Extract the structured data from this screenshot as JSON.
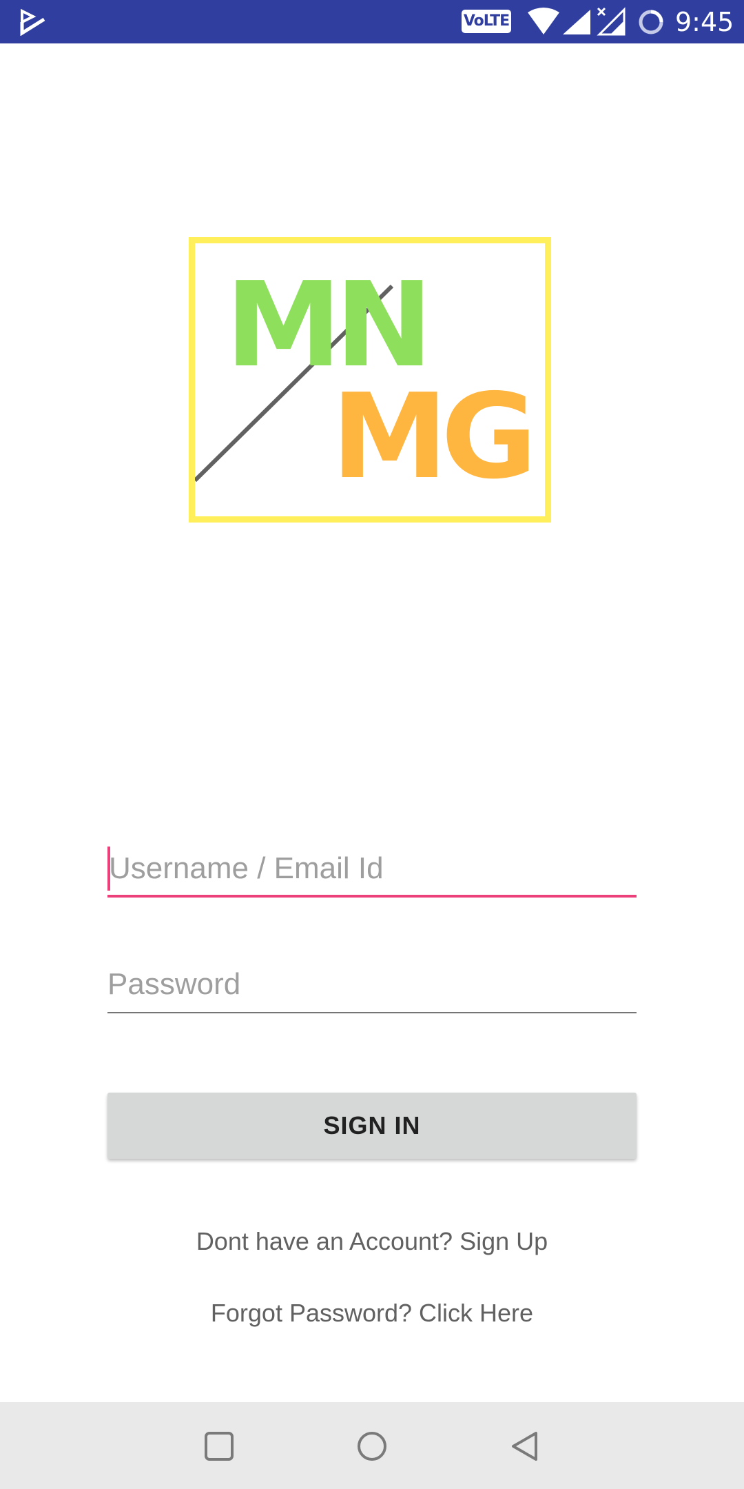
{
  "status_bar": {
    "time": "9:45",
    "volte_label": "VoLTE",
    "icons": [
      "app-notification-icon",
      "volte-icon",
      "wifi-icon",
      "signal-icon",
      "signal-no-data-icon",
      "sync-icon"
    ],
    "background_color": "#303f9f"
  },
  "logo": {
    "line1": "MN",
    "line2": "MG",
    "colors": {
      "border": "#ffef5a",
      "line1": "#8ee05c",
      "line2": "#ffb640",
      "diagonal": "#616161"
    }
  },
  "login_form": {
    "username_placeholder": "Username / Email Id",
    "password_placeholder": "Password",
    "signin_label": "SIGN IN",
    "signup_link": "Dont have an Account? Sign Up",
    "forgot_link": "Forgot Password? Click Here",
    "accent_color": "#ec407a"
  },
  "nav_bar": {
    "buttons": [
      "recents-icon",
      "home-icon",
      "back-icon"
    ]
  }
}
